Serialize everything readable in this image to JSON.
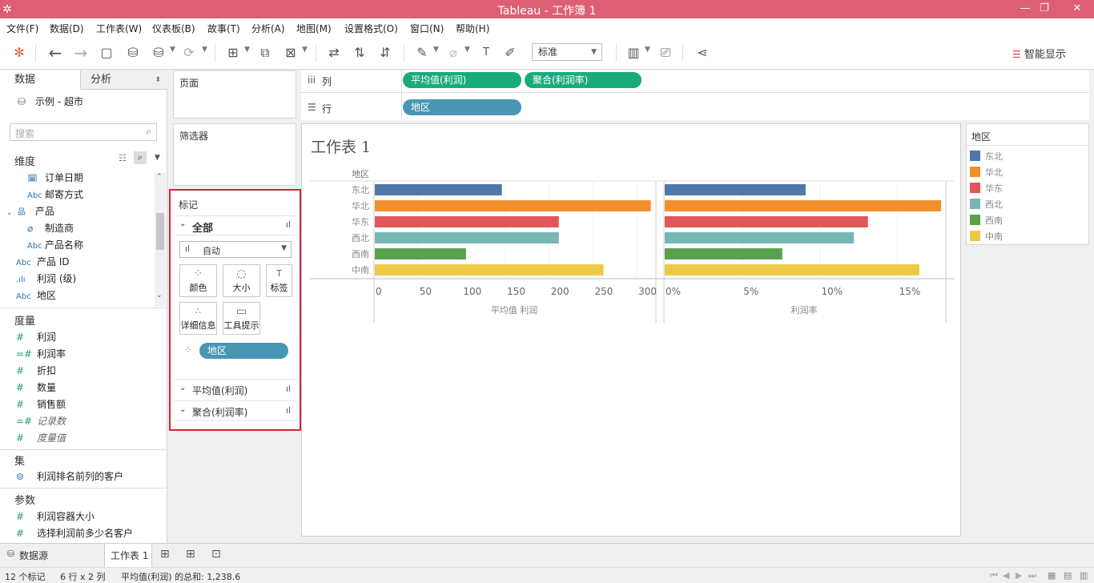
{
  "window": {
    "title": "Tableau - 工作簿 1"
  },
  "menu": [
    "文件(F)",
    "数据(D)",
    "工作表(W)",
    "仪表板(B)",
    "故事(T)",
    "分析(A)",
    "地图(M)",
    "设置格式(O)",
    "窗口(N)",
    "帮助(H)"
  ],
  "toolbar": {
    "fit_select": "标准",
    "smart_label": "智能显示"
  },
  "left": {
    "tab_data": "数据",
    "tab_analysis": "分析",
    "datasource": "示例 - 超市",
    "search_placeholder": "搜索",
    "dimensions_header": "维度",
    "dimensions": [
      {
        "icon": "calendar-icon",
        "label": "订单日期"
      },
      {
        "icon": "abc-icon",
        "label": "邮寄方式"
      },
      {
        "icon": "hierarchy-icon",
        "label": "产品"
      },
      {
        "icon": "paperclip-icon",
        "label": "制造商"
      },
      {
        "icon": "abc-icon",
        "label": "产品名称"
      },
      {
        "icon": "abc-icon",
        "label": "产品 ID"
      },
      {
        "icon": "bin-icon",
        "label": "利润 (级)"
      },
      {
        "icon": "abc-icon",
        "label": "地区"
      }
    ],
    "measures_header": "度量",
    "measures": [
      "利润",
      "利润率",
      "折扣",
      "数量",
      "销售额",
      "记录数",
      "度量值"
    ],
    "sets_header": "集",
    "sets": [
      "利润排名前列的客户"
    ],
    "params_header": "参数",
    "params": [
      "利润容器大小",
      "选择利润前多少名客户"
    ]
  },
  "shelf": {
    "pages": "页面",
    "filters": "筛选器",
    "marks": "标记",
    "marks_all": "全部",
    "mark_type": "自动",
    "mark_buttons": [
      "颜色",
      "大小",
      "标签",
      "详细信息",
      "工具提示"
    ],
    "color_pill": "地区",
    "marks_sub1": "平均值(利润)",
    "marks_sub2": "聚合(利润率)",
    "columns_label": "列",
    "rows_label": "行",
    "columns_pills": [
      "平均值(利润)",
      "聚合(利润率)"
    ],
    "rows_pills": [
      "地区"
    ]
  },
  "view": {
    "sheet_title": "工作表 1",
    "row_header": "地区"
  },
  "chart_data": [
    {
      "type": "bar",
      "orientation": "horizontal",
      "categories": [
        "东北",
        "华北",
        "华东",
        "西北",
        "西南",
        "中南"
      ],
      "values": [
        146,
        316,
        211,
        211,
        105,
        262
      ],
      "xlabel": "平均值 利润",
      "xlim": [
        0,
        320
      ],
      "ticks": [
        "0",
        "50",
        "100",
        "150",
        "200",
        "250",
        "300"
      ],
      "tick_values": [
        0,
        50,
        100,
        150,
        200,
        250,
        300
      ],
      "colors": [
        "#4e79a7",
        "#f28e2b",
        "#e15759",
        "#76b7b2",
        "#59a14f",
        "#edc948"
      ]
    },
    {
      "type": "bar",
      "orientation": "horizontal",
      "categories": [
        "东北",
        "华北",
        "华东",
        "西北",
        "西南",
        "中南"
      ],
      "values": [
        0.091,
        0.178,
        0.131,
        0.122,
        0.076,
        0.164
      ],
      "xlabel": "利润率",
      "xlim": [
        0,
        0.18
      ],
      "ticks": [
        "0%",
        "5%",
        "10%",
        "15%"
      ],
      "tick_values": [
        0,
        0.05,
        0.1,
        0.15
      ],
      "colors": [
        "#4e79a7",
        "#f28e2b",
        "#e15759",
        "#76b7b2",
        "#59a14f",
        "#edc948"
      ]
    }
  ],
  "legend": {
    "title": "地区",
    "items": [
      {
        "label": "东北",
        "color": "#4e79a7"
      },
      {
        "label": "华北",
        "color": "#f28e2b"
      },
      {
        "label": "华东",
        "color": "#e15759"
      },
      {
        "label": "西北",
        "color": "#76b7b2"
      },
      {
        "label": "西南",
        "color": "#59a14f"
      },
      {
        "label": "中南",
        "color": "#edc948"
      }
    ]
  },
  "tabs": {
    "datasource": "数据源",
    "sheet": "工作表 1"
  },
  "status": {
    "marks": "12 个标记",
    "dims": "6 行 x 2 列",
    "sum": "平均值(利润) 的总和: 1,238.6"
  },
  "highlight_color": "#d9232e"
}
